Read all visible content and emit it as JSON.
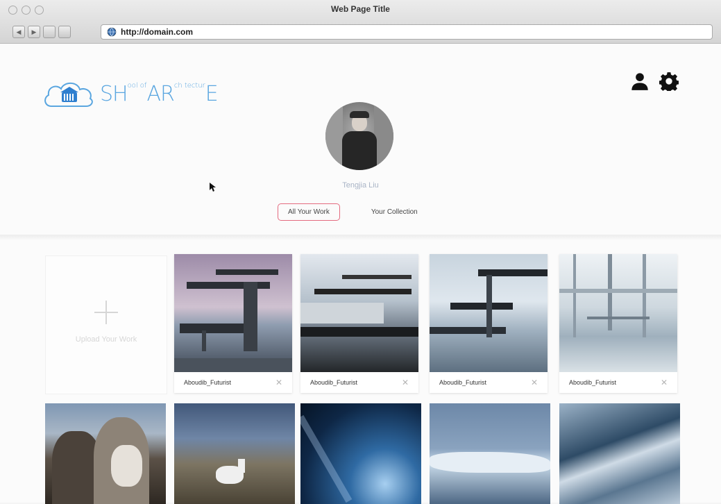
{
  "window": {
    "title": "Web Page Title",
    "url": "http://domain.com"
  },
  "brand": {
    "logo_main": "SH",
    "logo_small1": "ool\nof",
    "logo_mid": "AR",
    "logo_small2": "ch\ntectur",
    "logo_end": "E",
    "color": "#5aa6e0"
  },
  "header_icons": [
    "user-icon",
    "gear-icon"
  ],
  "profile": {
    "name": "Tengjia Liu"
  },
  "tabs": [
    {
      "label": "All Your Work",
      "active": true,
      "accent": "#e46a7f"
    },
    {
      "label": "Your Collection",
      "active": false
    }
  ],
  "upload": {
    "label": "Upload Your Work"
  },
  "works": [
    {
      "title": "Aboudib_Futurist",
      "close": "✕"
    },
    {
      "title": "Aboudib_Futurist",
      "close": "✕"
    },
    {
      "title": "Aboudib_Futurist",
      "close": "✕"
    },
    {
      "title": "Aboudib_Futurist",
      "close": "✕"
    }
  ],
  "photos": [
    {
      "subject": "horses"
    },
    {
      "subject": "white-horse-landscape"
    },
    {
      "subject": "ice-wave"
    },
    {
      "subject": "glacier-lagoon"
    },
    {
      "subject": "ice-surface"
    }
  ]
}
